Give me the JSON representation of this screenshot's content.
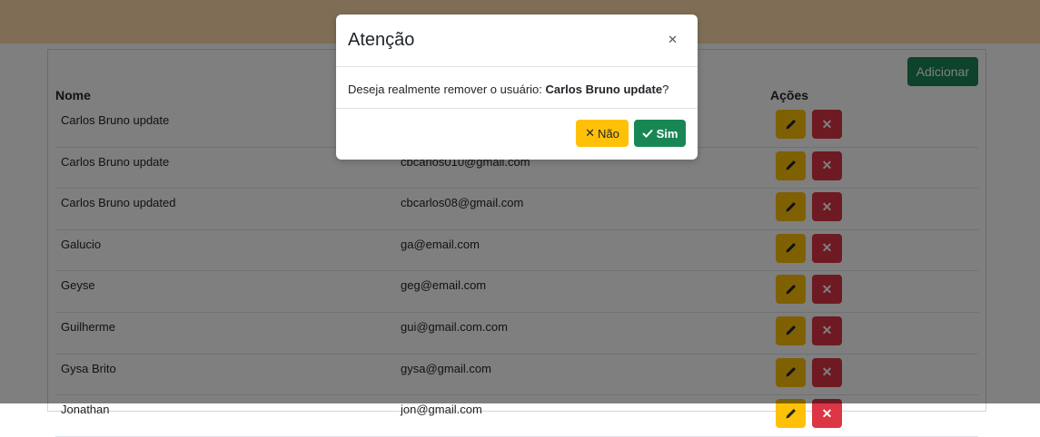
{
  "header": {
    "accent": "#ffdcaa"
  },
  "toolbar": {
    "add_label": "Adicionar"
  },
  "table": {
    "columns": {
      "name": "Nome",
      "actions": "Ações"
    },
    "rows": [
      {
        "name": "Carlos Bruno update",
        "email": ""
      },
      {
        "name": "Carlos Bruno update",
        "email": "cbcarlos010@gmail.com"
      },
      {
        "name": "Carlos Bruno updated",
        "email": "cbcarlos08@gmail.com"
      },
      {
        "name": "Galucio",
        "email": "ga@email.com"
      },
      {
        "name": "Geyse",
        "email": "geg@email.com"
      },
      {
        "name": "Guilherme",
        "email": "gui@gmail.com.com"
      },
      {
        "name": "Gysa Brito",
        "email": "gysa@gmail.com"
      },
      {
        "name": "Jonathan",
        "email": "jon@gmail.com"
      }
    ],
    "icons": {
      "edit": "pencil-icon",
      "delete": "x-icon"
    }
  },
  "modal": {
    "title": "Atenção",
    "close_icon": "close-icon",
    "message_prefix": "Deseja realmente remover o usuário: ",
    "message_name": "Carlos Bruno update",
    "message_suffix": "?",
    "no_label": "Não",
    "yes_label": "Sim"
  },
  "colors": {
    "success": "#198754",
    "warning": "#ffc107",
    "danger": "#dc3545"
  }
}
